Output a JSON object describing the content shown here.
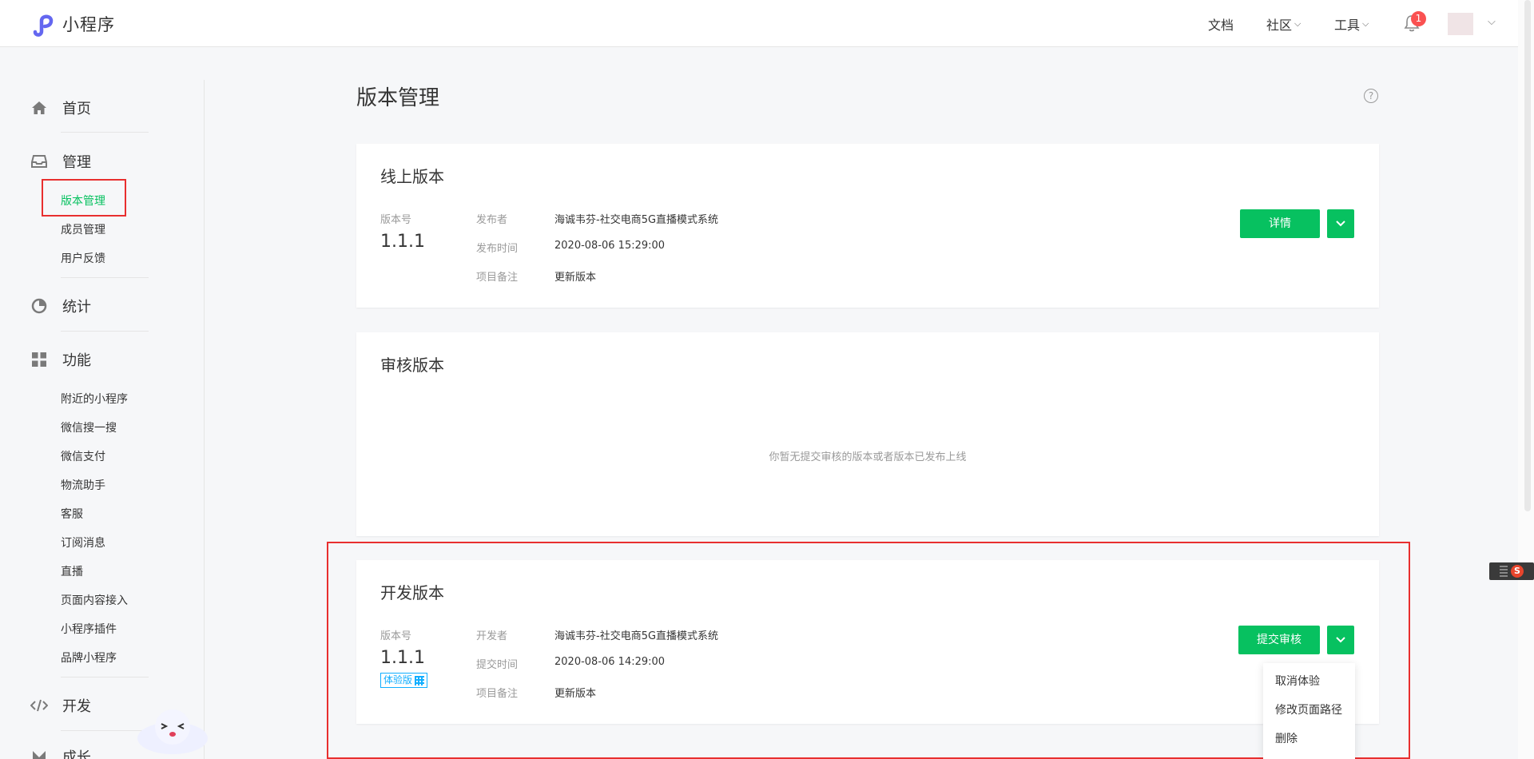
{
  "header": {
    "logo_text": "小程序",
    "nav": [
      {
        "label": "文档",
        "dropdown": false
      },
      {
        "label": "社区",
        "dropdown": true
      },
      {
        "label": "工具",
        "dropdown": true
      }
    ],
    "notification_count": "1"
  },
  "sidebar": {
    "groups": [
      {
        "label": "首页",
        "icon": "home-icon"
      },
      {
        "label": "管理",
        "icon": "inbox-icon",
        "items": [
          "版本管理",
          "成员管理",
          "用户反馈"
        ]
      },
      {
        "label": "统计",
        "icon": "pie-chart-icon"
      },
      {
        "label": "功能",
        "icon": "grid-icon",
        "items": [
          "附近的小程序",
          "微信搜一搜",
          "微信支付",
          "物流助手",
          "客服",
          "订阅消息",
          "直播",
          "页面内容接入",
          "小程序插件",
          "品牌小程序"
        ]
      },
      {
        "label": "开发",
        "icon": "code-icon"
      },
      {
        "label": "成长",
        "icon": "growth-icon"
      }
    ],
    "active_item": "版本管理"
  },
  "page": {
    "title": "版本管理"
  },
  "online": {
    "title": "线上版本",
    "version_label": "版本号",
    "version": "1.1.1",
    "fields": [
      {
        "label": "发布者",
        "value": "海诚韦芬-社交电商5G直播模式系统"
      },
      {
        "label": "发布时间",
        "value": "2020-08-06 15:29:00"
      },
      {
        "label": "项目备注",
        "value": "更新版本"
      }
    ],
    "button": "详情"
  },
  "review": {
    "title": "审核版本",
    "empty_text": "你暂无提交审核的版本或者版本已发布上线"
  },
  "dev": {
    "title": "开发版本",
    "version_label": "版本号",
    "version": "1.1.1",
    "badge": "体验版",
    "fields": [
      {
        "label": "开发者",
        "value": "海诚韦芬-社交电商5G直播模式系统"
      },
      {
        "label": "提交时间",
        "value": "2020-08-06 14:29:00"
      },
      {
        "label": "项目备注",
        "value": "更新版本"
      }
    ],
    "button": "提交审核",
    "dropdown": [
      "取消体验",
      "修改页面路径",
      "删除"
    ]
  },
  "colors": {
    "brand_green": "#07c160",
    "highlight_red": "#e82f2f",
    "link_blue": "#10aeff"
  }
}
